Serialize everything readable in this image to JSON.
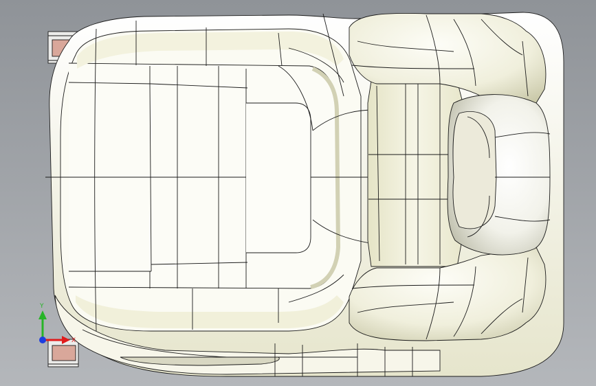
{
  "viewport": {
    "background_top": "#8f9398",
    "background_bottom": "#b4b7bb",
    "model_fill": "#fbfbf3",
    "model_shadow": "#d9d8bd",
    "edge_color": "#1a1a1a",
    "rail_color": "#d9a79a"
  },
  "triad": {
    "x_label": "X",
    "y_label": "Y",
    "x_color": "#e01b1b",
    "y_color": "#27b427",
    "z_color": "#1c3ee0"
  }
}
